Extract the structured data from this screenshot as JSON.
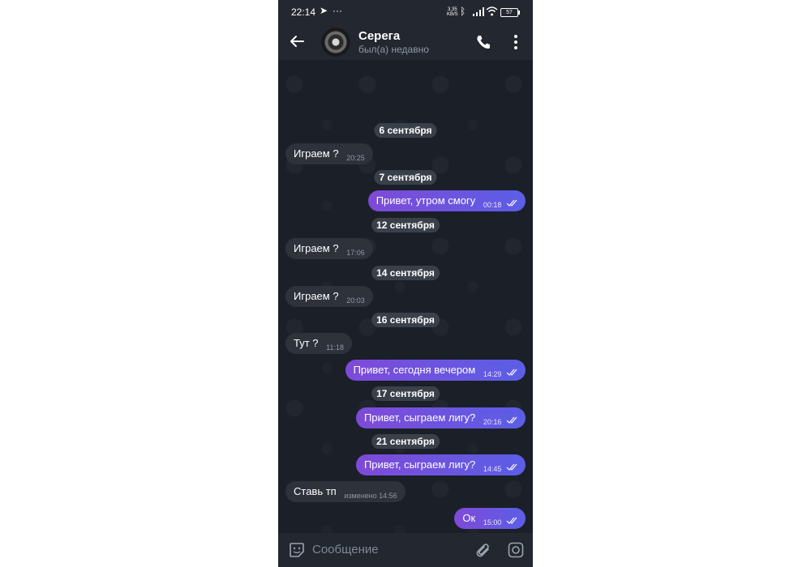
{
  "status_bar": {
    "time": "22:14",
    "speed_value": "3,35",
    "speed_unit": "KB/S",
    "battery": "57"
  },
  "header": {
    "name": "Серега",
    "status": "был(а) недавно"
  },
  "messages": [
    {
      "date": "6 сентября"
    },
    {
      "text": "Играем ?",
      "time": "20:25"
    },
    {
      "date": "7 сентября"
    },
    {
      "text": "Привет, утром смогу",
      "time": "00:18"
    },
    {
      "date": "12 сентября"
    },
    {
      "text": "Играем ?",
      "time": "17:06"
    },
    {
      "date": "14 сентября"
    },
    {
      "text": "Играем ?",
      "time": "20:03"
    },
    {
      "date": "16 сентября"
    },
    {
      "text": "Тут ?",
      "time": "11:18"
    },
    {
      "text": "Привет, сегодня вечером",
      "time": "14:29"
    },
    {
      "date": "17 сентября"
    },
    {
      "text": "Привет, сыграем лигу?",
      "time": "20:16"
    },
    {
      "date": "21 сентября"
    },
    {
      "text": "Привет, сыграем лигу?",
      "time": "14:45"
    },
    {
      "text": "Ставь тп",
      "time": "изменено 14:56"
    },
    {
      "text": "Ок",
      "time": "15:00"
    }
  ],
  "input": {
    "placeholder": "Сообщение"
  },
  "colors": {
    "outgoing_bubble_start": "#7e4ad8",
    "outgoing_bubble_end": "#5b5ee6",
    "incoming_bubble": "#2d323b",
    "background": "#1b1f27"
  }
}
